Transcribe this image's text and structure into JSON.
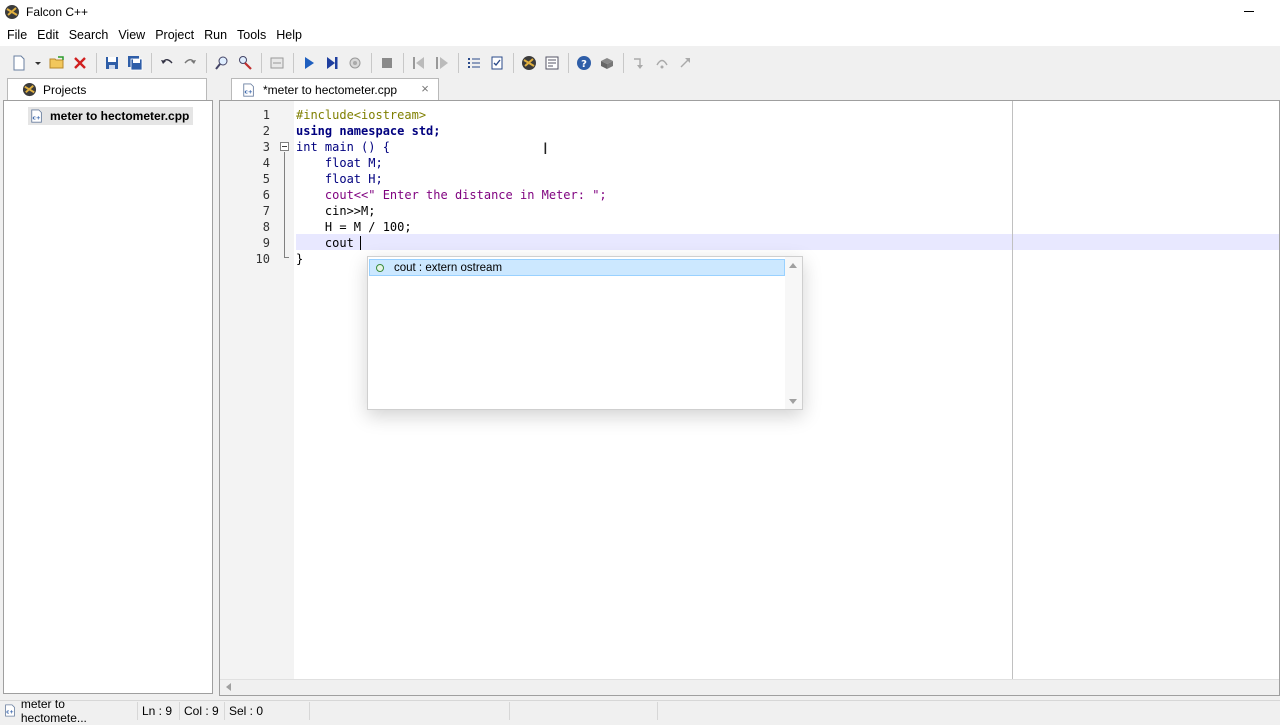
{
  "window": {
    "title": "Falcon C++",
    "app_icon": "falcon-logo-icon"
  },
  "menu": [
    "File",
    "Edit",
    "Search",
    "View",
    "Project",
    "Run",
    "Tools",
    "Help"
  ],
  "toolbar": {
    "buttons": [
      "new-file-icon",
      "open-folder-icon",
      "close-icon",
      "save-icon",
      "save-all-icon",
      "undo-icon",
      "redo-icon",
      "find-icon",
      "replace-icon",
      "compile-icon",
      "run-icon",
      "step-run-icon",
      "debug-icon",
      "stop-icon",
      "prev-icon",
      "next-icon",
      "list-icon",
      "checklist-icon",
      "falcon-icon",
      "settings-icon",
      "help-icon",
      "package-icon",
      "step-into-icon",
      "step-over-icon",
      "step-out-icon"
    ]
  },
  "projects_panel": {
    "tab_label": "Projects",
    "items": [
      {
        "label": "meter to hectometer.cpp",
        "icon": "cpp-file-icon"
      }
    ]
  },
  "editor": {
    "tab_label": "*meter to hectometer.cpp",
    "close_glyph": "×",
    "lines": [
      {
        "num": "1",
        "code": "#include<iostream>"
      },
      {
        "num": "2",
        "code": "using namespace std;"
      },
      {
        "num": "3",
        "code": "int main () {"
      },
      {
        "num": "4",
        "code": "    float M;"
      },
      {
        "num": "5",
        "code": "    float H;"
      },
      {
        "num": "6",
        "code": "    cout<<\" Enter the distance in Meter: \";"
      },
      {
        "num": "7",
        "code": "    cin>>M;"
      },
      {
        "num": "8",
        "code": "    H = M / 100;"
      },
      {
        "num": "9",
        "code": "    cout"
      },
      {
        "num": "10",
        "code": "}"
      }
    ],
    "current_line": 9
  },
  "autocomplete": {
    "items": [
      {
        "label": "cout : extern ostream",
        "selected": true
      }
    ]
  },
  "statusbar": {
    "file": "meter to hectomete...",
    "line": "Ln : 9",
    "col": "Col : 9",
    "sel": "Sel : 0"
  },
  "colors": {
    "keyword": "#00007f",
    "preprocessor": "#7f7f00",
    "string": "#7f007f",
    "number": "#ff7f00",
    "current_line": "#e8e8ff",
    "selection": "#cce8ff"
  }
}
